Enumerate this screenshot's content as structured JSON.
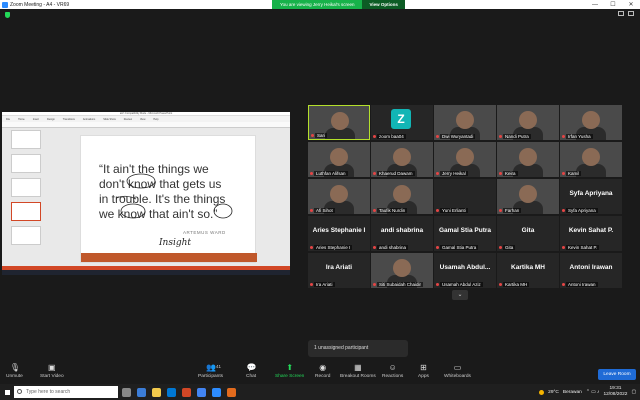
{
  "window": {
    "title": "Zoom Meeting - A4 - VR69",
    "share_message": "You are viewing Jerry Heikal's screen",
    "view_options": "View Options",
    "btn_min": "—",
    "btn_max": "☐",
    "btn_close": "✕"
  },
  "shared_slide": {
    "ppt_title": "ain't Compatibility Mode - Microsoft PowerPoint",
    "ribbon": [
      "File",
      "Home",
      "Insert",
      "Design",
      "Transitions",
      "Animations",
      "Slide Show",
      "Review",
      "View",
      "Help"
    ],
    "quote_lines": [
      "“It ain't the things we",
      "don't know that gets us",
      "in trouble. It's the things",
      "we know that ain't so.”"
    ],
    "author": "ARTEMUS WARD",
    "signature": "Insight"
  },
  "participants": [
    {
      "name": "Sari",
      "video": true,
      "active": true
    },
    {
      "name": "zoom baa04",
      "video": false,
      "avatar_letter": "Z"
    },
    {
      "name": "Dwi Wuryantadi",
      "video": true
    },
    {
      "name": "Nandi Putra",
      "video": true
    },
    {
      "name": "Irfan Yusha",
      "video": true
    },
    {
      "name": "Luthfan Alifsan",
      "video": true
    },
    {
      "name": "Khaerud Dawam",
      "video": true
    },
    {
      "name": "Jerry Heikal",
      "video": true
    },
    {
      "name": "Keira",
      "video": true
    },
    {
      "name": "Kamil",
      "video": true
    },
    {
      "name": "Afi Sihot",
      "video": true
    },
    {
      "name": "Taufik Nurdin",
      "video": true
    },
    {
      "name": "Yuni Erlianti",
      "video": false,
      "big_name": ""
    },
    {
      "name": "Farhan",
      "video": true
    },
    {
      "name": "Syfa Apriyana",
      "video": false,
      "big_name": "Syfa Apriyana"
    },
    {
      "name": "Aries Stephanie I",
      "video": false,
      "big_name": "Aries Stephanie I"
    },
    {
      "name": "andi shabrina",
      "video": false,
      "big_name": "andi shabrina"
    },
    {
      "name": "Gamal Stia Putra",
      "video": false,
      "big_name": "Gamal Stia Putra"
    },
    {
      "name": "Gita",
      "video": false,
      "big_name": "Gita"
    },
    {
      "name": "Kevin Sahat P.",
      "video": false,
      "big_name": "Kevin Sahat P."
    },
    {
      "name": "Ira Ariati",
      "video": false,
      "big_name": "Ira Ariati"
    },
    {
      "name": "Siti Subaidah Chaidir",
      "video": true
    },
    {
      "name": "Usamah Abdul Aziz",
      "video": false,
      "big_name": "Usamah Abdul..."
    },
    {
      "name": "Kartika MH",
      "video": false,
      "big_name": "Kartika MH"
    },
    {
      "name": "Antoni Irawan",
      "video": false,
      "big_name": "Antoni Irawan"
    }
  ],
  "gallery_more": "⌄",
  "unassigned_text": "1 unassigned participant",
  "controls": {
    "unmute": "Unmute",
    "start_video": "Start Video",
    "participants": "Participants",
    "participants_count": "41",
    "chat": "Chat",
    "share_screen": "Share Screen",
    "record": "Record",
    "breakout_rooms": "Breakout Rooms",
    "reactions": "Reactions",
    "apps": "Apps",
    "whiteboards": "Whiteboards",
    "leave": "Leave Room"
  },
  "taskbar": {
    "search_placeholder": "Type here to search",
    "weather": "29°C",
    "weather_desc": "Berawan",
    "time": "19:31",
    "date": "12/08/2022"
  },
  "colors": {
    "share_green": "#23d959",
    "active_speaker": "#b4e02b",
    "leave_blue": "#1f6bd6",
    "ppt_orange": "#d24726"
  }
}
